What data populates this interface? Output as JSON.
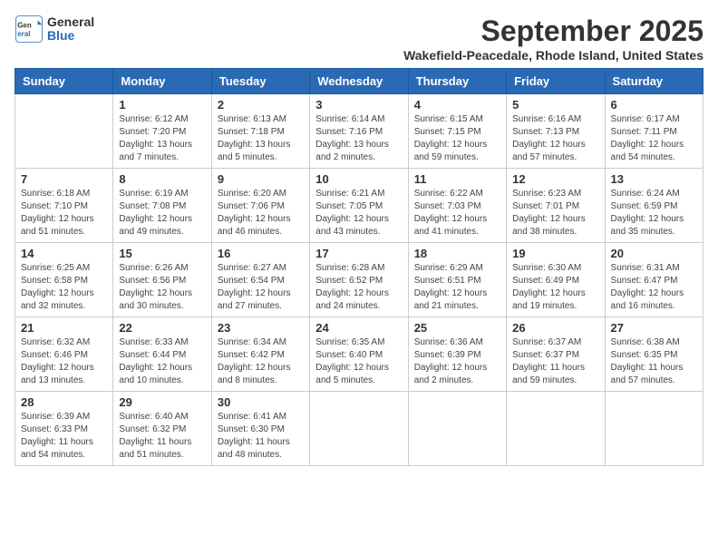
{
  "header": {
    "logo_general": "General",
    "logo_blue": "Blue",
    "month_title": "September 2025",
    "subtitle": "Wakefield-Peacedale, Rhode Island, United States"
  },
  "days_of_week": [
    "Sunday",
    "Monday",
    "Tuesday",
    "Wednesday",
    "Thursday",
    "Friday",
    "Saturday"
  ],
  "weeks": [
    [
      {
        "day": "",
        "info": ""
      },
      {
        "day": "1",
        "info": "Sunrise: 6:12 AM\nSunset: 7:20 PM\nDaylight: 13 hours\nand 7 minutes."
      },
      {
        "day": "2",
        "info": "Sunrise: 6:13 AM\nSunset: 7:18 PM\nDaylight: 13 hours\nand 5 minutes."
      },
      {
        "day": "3",
        "info": "Sunrise: 6:14 AM\nSunset: 7:16 PM\nDaylight: 13 hours\nand 2 minutes."
      },
      {
        "day": "4",
        "info": "Sunrise: 6:15 AM\nSunset: 7:15 PM\nDaylight: 12 hours\nand 59 minutes."
      },
      {
        "day": "5",
        "info": "Sunrise: 6:16 AM\nSunset: 7:13 PM\nDaylight: 12 hours\nand 57 minutes."
      },
      {
        "day": "6",
        "info": "Sunrise: 6:17 AM\nSunset: 7:11 PM\nDaylight: 12 hours\nand 54 minutes."
      }
    ],
    [
      {
        "day": "7",
        "info": "Sunrise: 6:18 AM\nSunset: 7:10 PM\nDaylight: 12 hours\nand 51 minutes."
      },
      {
        "day": "8",
        "info": "Sunrise: 6:19 AM\nSunset: 7:08 PM\nDaylight: 12 hours\nand 49 minutes."
      },
      {
        "day": "9",
        "info": "Sunrise: 6:20 AM\nSunset: 7:06 PM\nDaylight: 12 hours\nand 46 minutes."
      },
      {
        "day": "10",
        "info": "Sunrise: 6:21 AM\nSunset: 7:05 PM\nDaylight: 12 hours\nand 43 minutes."
      },
      {
        "day": "11",
        "info": "Sunrise: 6:22 AM\nSunset: 7:03 PM\nDaylight: 12 hours\nand 41 minutes."
      },
      {
        "day": "12",
        "info": "Sunrise: 6:23 AM\nSunset: 7:01 PM\nDaylight: 12 hours\nand 38 minutes."
      },
      {
        "day": "13",
        "info": "Sunrise: 6:24 AM\nSunset: 6:59 PM\nDaylight: 12 hours\nand 35 minutes."
      }
    ],
    [
      {
        "day": "14",
        "info": "Sunrise: 6:25 AM\nSunset: 6:58 PM\nDaylight: 12 hours\nand 32 minutes."
      },
      {
        "day": "15",
        "info": "Sunrise: 6:26 AM\nSunset: 6:56 PM\nDaylight: 12 hours\nand 30 minutes."
      },
      {
        "day": "16",
        "info": "Sunrise: 6:27 AM\nSunset: 6:54 PM\nDaylight: 12 hours\nand 27 minutes."
      },
      {
        "day": "17",
        "info": "Sunrise: 6:28 AM\nSunset: 6:52 PM\nDaylight: 12 hours\nand 24 minutes."
      },
      {
        "day": "18",
        "info": "Sunrise: 6:29 AM\nSunset: 6:51 PM\nDaylight: 12 hours\nand 21 minutes."
      },
      {
        "day": "19",
        "info": "Sunrise: 6:30 AM\nSunset: 6:49 PM\nDaylight: 12 hours\nand 19 minutes."
      },
      {
        "day": "20",
        "info": "Sunrise: 6:31 AM\nSunset: 6:47 PM\nDaylight: 12 hours\nand 16 minutes."
      }
    ],
    [
      {
        "day": "21",
        "info": "Sunrise: 6:32 AM\nSunset: 6:46 PM\nDaylight: 12 hours\nand 13 minutes."
      },
      {
        "day": "22",
        "info": "Sunrise: 6:33 AM\nSunset: 6:44 PM\nDaylight: 12 hours\nand 10 minutes."
      },
      {
        "day": "23",
        "info": "Sunrise: 6:34 AM\nSunset: 6:42 PM\nDaylight: 12 hours\nand 8 minutes."
      },
      {
        "day": "24",
        "info": "Sunrise: 6:35 AM\nSunset: 6:40 PM\nDaylight: 12 hours\nand 5 minutes."
      },
      {
        "day": "25",
        "info": "Sunrise: 6:36 AM\nSunset: 6:39 PM\nDaylight: 12 hours\nand 2 minutes."
      },
      {
        "day": "26",
        "info": "Sunrise: 6:37 AM\nSunset: 6:37 PM\nDaylight: 11 hours\nand 59 minutes."
      },
      {
        "day": "27",
        "info": "Sunrise: 6:38 AM\nSunset: 6:35 PM\nDaylight: 11 hours\nand 57 minutes."
      }
    ],
    [
      {
        "day": "28",
        "info": "Sunrise: 6:39 AM\nSunset: 6:33 PM\nDaylight: 11 hours\nand 54 minutes."
      },
      {
        "day": "29",
        "info": "Sunrise: 6:40 AM\nSunset: 6:32 PM\nDaylight: 11 hours\nand 51 minutes."
      },
      {
        "day": "30",
        "info": "Sunrise: 6:41 AM\nSunset: 6:30 PM\nDaylight: 11 hours\nand 48 minutes."
      },
      {
        "day": "",
        "info": ""
      },
      {
        "day": "",
        "info": ""
      },
      {
        "day": "",
        "info": ""
      },
      {
        "day": "",
        "info": ""
      }
    ]
  ]
}
